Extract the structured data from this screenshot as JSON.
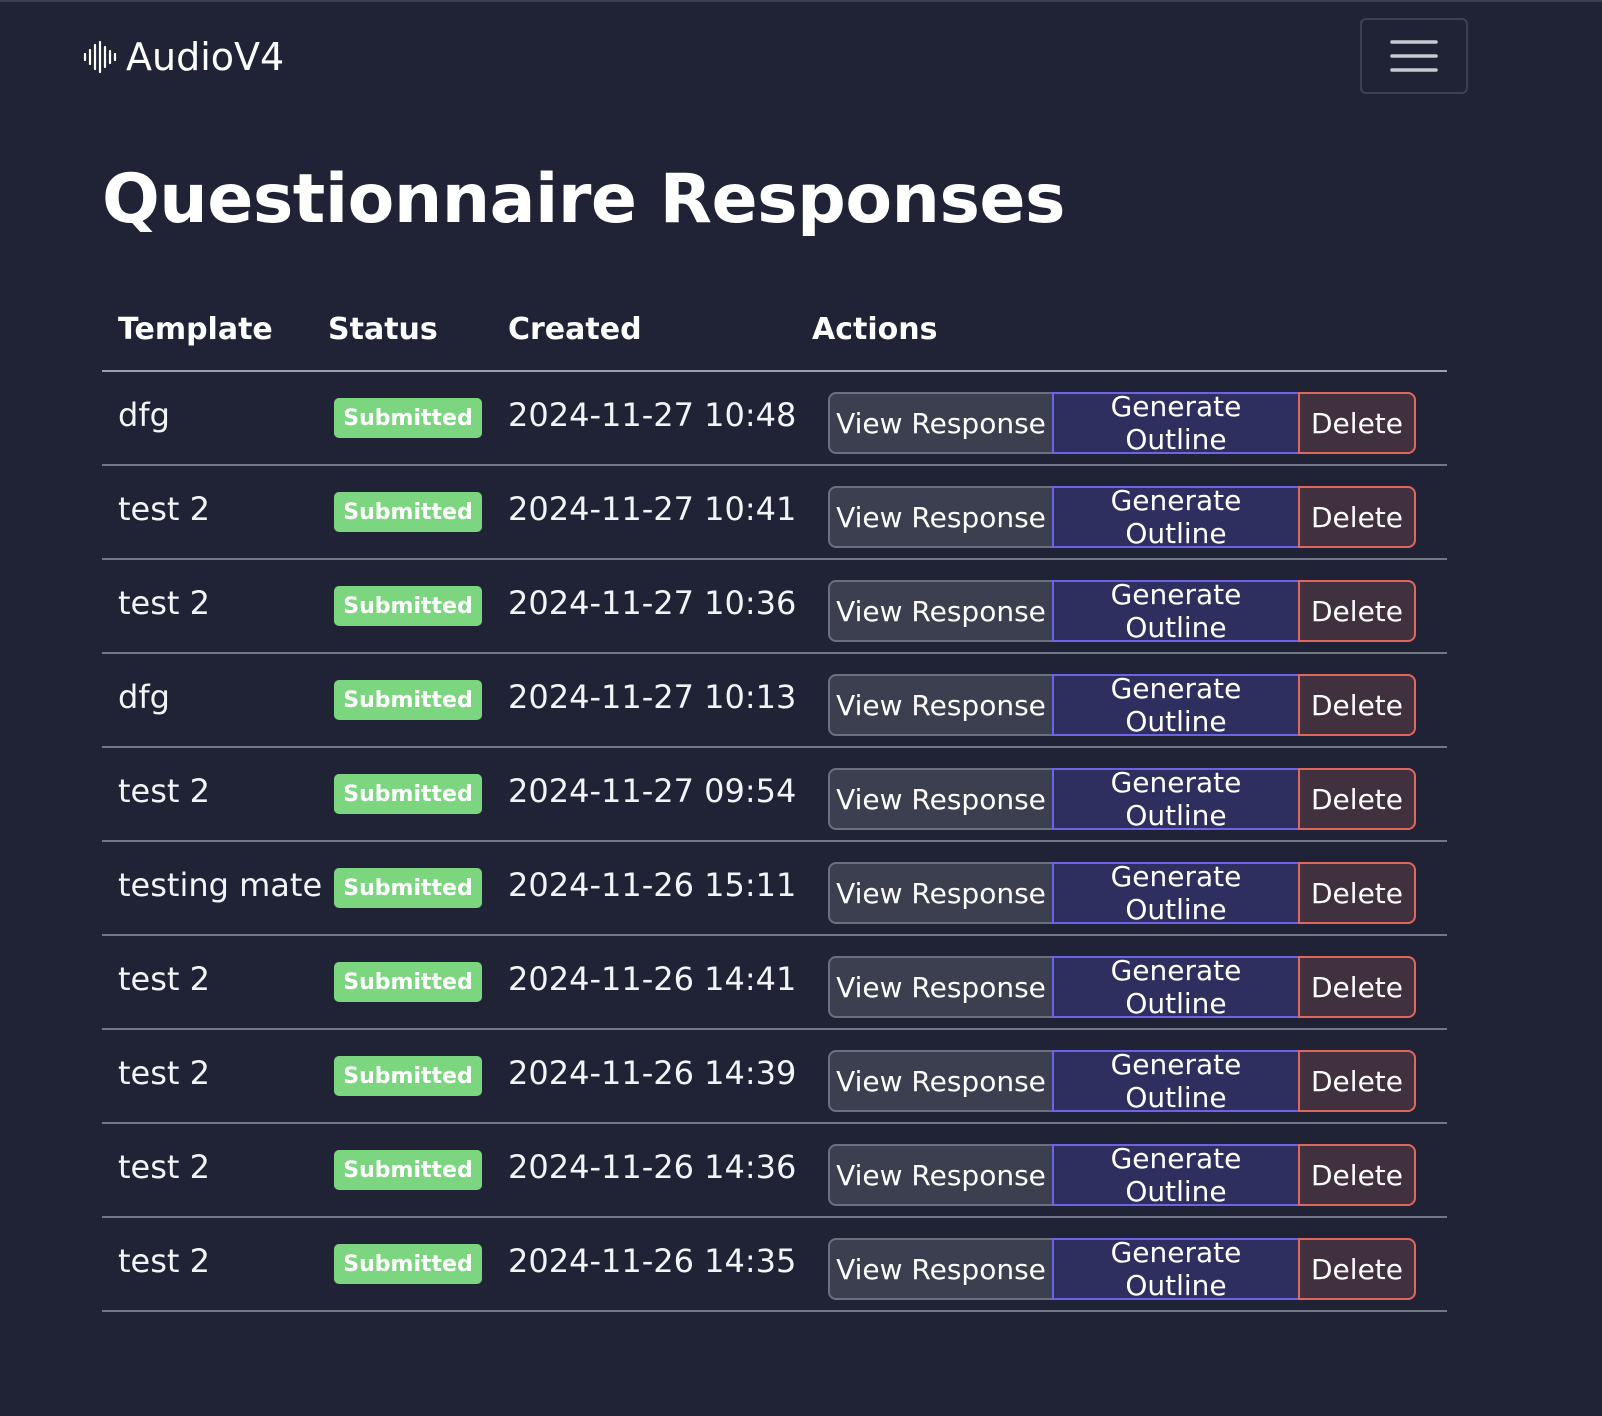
{
  "app": {
    "brand": "AudioV4",
    "brand_icon": "audio-waveform-icon",
    "menu_icon": "hamburger-menu-icon"
  },
  "page": {
    "title": "Questionnaire Responses"
  },
  "table": {
    "headers": {
      "template": "Template",
      "status": "Status",
      "created": "Created",
      "actions": "Actions"
    },
    "rows": [
      {
        "template": "dfg",
        "status": "Submitted",
        "created": "2024-11-27 10:48",
        "view": "View Response",
        "outline": "Generate Outline",
        "delete": "Delete"
      },
      {
        "template": "test 2",
        "status": "Submitted",
        "created": "2024-11-27 10:41",
        "view": "View Response",
        "outline": "Generate Outline",
        "delete": "Delete"
      },
      {
        "template": "test 2",
        "status": "Submitted",
        "created": "2024-11-27 10:36",
        "view": "View Response",
        "outline": "Generate Outline",
        "delete": "Delete"
      },
      {
        "template": "dfg",
        "status": "Submitted",
        "created": "2024-11-27 10:13",
        "view": "View Response",
        "outline": "Generate Outline",
        "delete": "Delete"
      },
      {
        "template": "test 2",
        "status": "Submitted",
        "created": "2024-11-27 09:54",
        "view": "View Response",
        "outline": "Generate Outline",
        "delete": "Delete"
      },
      {
        "template": "testing mate",
        "status": "Submitted",
        "created": "2024-11-26 15:11",
        "view": "View Response",
        "outline": "Generate Outline",
        "delete": "Delete"
      },
      {
        "template": "test 2",
        "status": "Submitted",
        "created": "2024-11-26 14:41",
        "view": "View Response",
        "outline": "Generate Outline",
        "delete": "Delete"
      },
      {
        "template": "test 2",
        "status": "Submitted",
        "created": "2024-11-26 14:39",
        "view": "View Response",
        "outline": "Generate Outline",
        "delete": "Delete"
      },
      {
        "template": "test 2",
        "status": "Submitted",
        "created": "2024-11-26 14:36",
        "view": "View Response",
        "outline": "Generate Outline",
        "delete": "Delete"
      },
      {
        "template": "test 2",
        "status": "Submitted",
        "created": "2024-11-26 14:35",
        "view": "View Response",
        "outline": "Generate Outline",
        "delete": "Delete"
      }
    ]
  },
  "colors": {
    "background": "#1f2335",
    "badge_success": "#7cd67f",
    "view_button": "#3b3f50",
    "outline_button": "#2e2f5e",
    "outline_border": "#6c63e6",
    "delete_button": "#41303d",
    "delete_border": "#e0675e"
  }
}
